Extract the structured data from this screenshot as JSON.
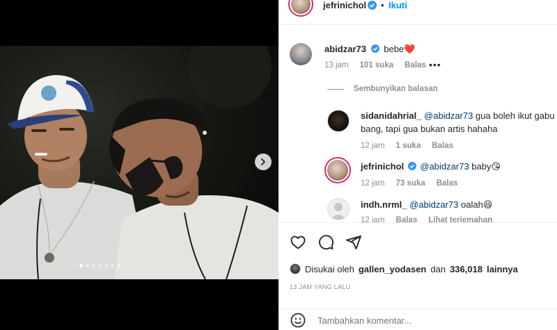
{
  "header": {
    "username": "jefrinichol",
    "follow_separator": "•",
    "follow_label": "Ikuti"
  },
  "media": {
    "carousel_dot_count": 7,
    "active_dot": 0
  },
  "comments": [
    {
      "username": "abidzar73",
      "text": "bebe",
      "emoji": "❤️",
      "time": "13 jam",
      "likes": "101 suka",
      "reply_label": "Balas",
      "more": "•••"
    }
  ],
  "hide_replies_label": "Sembunyikan balasan",
  "replies": [
    {
      "username": "sidanidahrial_",
      "mention": "@abidzar73",
      "text_line1": "gua boleh ikut gabu",
      "text_line2": "bang, tapi gua bukan artis hahaha",
      "time": "12 jam",
      "likes": "1 suka",
      "reply_label": "Balas"
    },
    {
      "username": "jefrinichol",
      "mention": "@abidzar73",
      "text": "baby",
      "emoji": "😘",
      "time": "12 jam",
      "likes": "73 suka",
      "reply_label": "Balas"
    },
    {
      "username": "indh.nrml_",
      "mention": "@abidzar73",
      "text": "oalah",
      "emoji": "😆",
      "time": "12 jam",
      "reply_label": "Balas",
      "see_translation": "Lihat terjemahan"
    }
  ],
  "likes_line": {
    "prefix": "Disukai oleh",
    "user": "gallen_yodasen",
    "middle": "dan",
    "count": "336,018",
    "suffix": "lainnya"
  },
  "timestamp": "13 JAM YANG LALU",
  "add_comment_placeholder": "Tambahkan komentar...",
  "colors": {
    "accent": "#0095f6",
    "verified": "#3897f0",
    "story_ring": "#d62976"
  }
}
